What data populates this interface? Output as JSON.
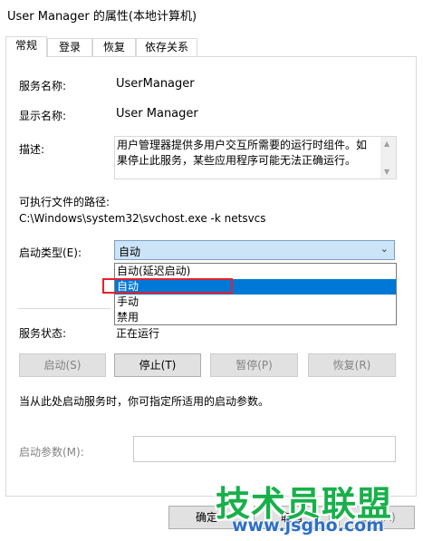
{
  "window": {
    "title": "User Manager 的属性(本地计算机)"
  },
  "tabs": [
    {
      "label": "常规",
      "active": true
    },
    {
      "label": "登录",
      "active": false
    },
    {
      "label": "恢复",
      "active": false
    },
    {
      "label": "依存关系",
      "active": false
    }
  ],
  "general": {
    "service_name_label": "服务名称:",
    "service_name_value": "UserManager",
    "display_name_label": "显示名称:",
    "display_name_value": "User Manager",
    "description_label": "描述:",
    "description_value": "用户管理器提供多用户交互所需要的运行时组件。如果停止此服务，某些应用程序可能无法正确运行。",
    "exe_path_label": "可执行文件的路径:",
    "exe_path_value": "C:\\Windows\\system32\\svchost.exe -k netsvcs",
    "startup_type_label": "启动类型(E):",
    "startup_type_value": "自动",
    "startup_options": [
      "自动(延迟启动)",
      "自动",
      "手动",
      "禁用"
    ],
    "startup_selected_index": 1,
    "service_status_label": "服务状态:",
    "service_status_value": "正在运行",
    "buttons": {
      "start": "启动(S)",
      "stop": "停止(T)",
      "pause": "暂停(P)",
      "resume": "恢复(R)"
    },
    "hint": "当从此处启动服务时，你可指定所适用的启动参数。",
    "start_params_label": "启动参数(M):",
    "start_params_value": ""
  },
  "footer": {
    "ok": "确定",
    "cancel": "取消",
    "apply": "应用(A)"
  },
  "watermark": {
    "text": "技术员联盟",
    "url": "www.jsgho.com"
  },
  "colors": {
    "selection": "#0078d7",
    "highlight_box": "#e8202a",
    "watermark_green": "#18b04a",
    "watermark_blue": "#2e6fc4"
  }
}
